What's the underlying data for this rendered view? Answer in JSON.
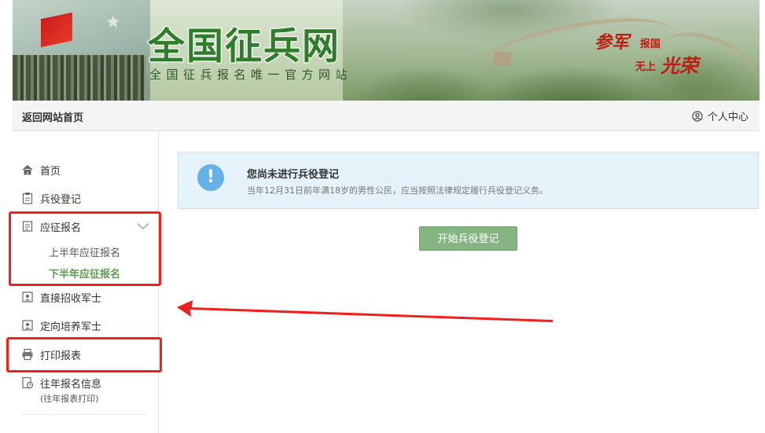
{
  "banner": {
    "title": "全国征兵网",
    "subtitle": "全国征兵报名唯一官方网站",
    "slogan": {
      "part1_big": "参军",
      "part1_small": "报国",
      "part2_small": "无上",
      "part2_big": "光荣"
    }
  },
  "topbar": {
    "back_home": "返回网站首页",
    "user_center": "个人中心"
  },
  "sidebar": {
    "items": [
      {
        "label": "首页",
        "icon": "home-icon"
      },
      {
        "label": "兵役登记",
        "icon": "clipboard-icon"
      },
      {
        "label": "应征报名",
        "icon": "document-icon",
        "expanded": true
      },
      {
        "label": "直接招收军士",
        "icon": "id-card-icon"
      },
      {
        "label": "定向培养军士",
        "icon": "id-card-icon"
      },
      {
        "label": "打印报表",
        "icon": "printer-icon"
      },
      {
        "label": "往年报名信息",
        "icon": "history-icon",
        "note": "(往年报表打印)"
      }
    ],
    "subitems": [
      {
        "label": "上半年应征报名",
        "active": false
      },
      {
        "label": "下半年应征报名",
        "active": true
      }
    ]
  },
  "alert": {
    "title": "您尚未进行兵役登记",
    "description": "当年12月31日前年满18岁的男性公民，应当按照法律规定履行兵役登记义务。",
    "icon": "exclamation-icon"
  },
  "start_button": {
    "label": "开始兵役登记"
  },
  "colors": {
    "accent_green": "#86b583",
    "active_green": "#5d9b50",
    "alert_bg": "#e6f2fa",
    "alert_icon": "#66b1e6",
    "annotation_red": "#f0201c",
    "brand_red": "#c41a14"
  }
}
